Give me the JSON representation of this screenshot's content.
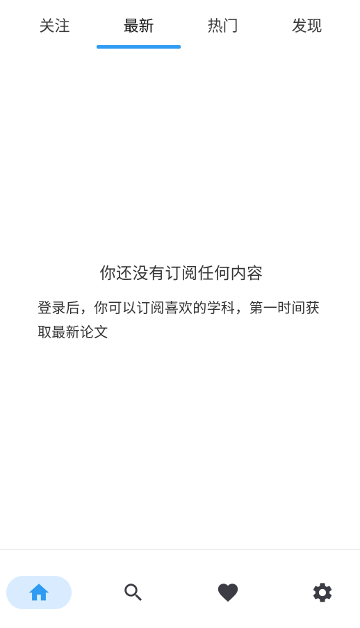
{
  "tabs": [
    {
      "label": "关注",
      "active": false
    },
    {
      "label": "最新",
      "active": true
    },
    {
      "label": "热门",
      "active": false
    },
    {
      "label": "发现",
      "active": false
    }
  ],
  "empty_state": {
    "title": "你还没有订阅任何内容",
    "description": "登录后，你可以订阅喜欢的学科，第一时间获取最新论文"
  },
  "bottom_nav": [
    {
      "icon": "home-icon",
      "active": true
    },
    {
      "icon": "search-icon",
      "active": false
    },
    {
      "icon": "heart-icon",
      "active": false
    },
    {
      "icon": "gear-icon",
      "active": false
    }
  ],
  "colors": {
    "accent": "#2f9bf2",
    "active_nav_bg": "#d9ecff",
    "icon_default": "#3c3c44",
    "text": "#333333"
  }
}
